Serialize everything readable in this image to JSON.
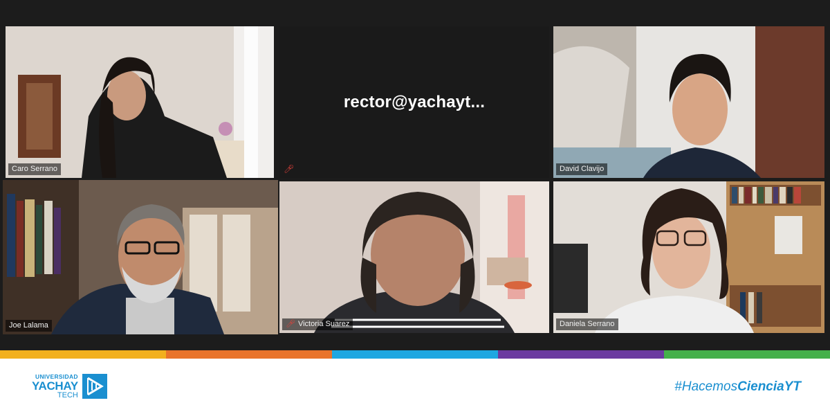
{
  "participants": [
    {
      "name": "Caro Serrano",
      "muted": false,
      "video": true
    },
    {
      "name": "rector@yachayt...",
      "muted": true,
      "video": false
    },
    {
      "name": "David Clavijo",
      "muted": false,
      "video": true
    },
    {
      "name": "Joe Lalama",
      "muted": false,
      "video": true,
      "active_speaker": true
    },
    {
      "name": "Victoria Suarez",
      "muted": true,
      "video": true
    },
    {
      "name": "Daniela Serrano",
      "muted": false,
      "video": true
    }
  ],
  "stripe_colors": [
    "#f2b01e",
    "#e9732a",
    "#1ea7e1",
    "#6b3aa0",
    "#44b04a"
  ],
  "footer": {
    "logo": {
      "line1": "UNIVERSIDAD",
      "line2": "YACHAY",
      "line3": "TECH"
    },
    "hashtag_prefix": "#Hacemos",
    "hashtag_bold": "CienciaYT"
  },
  "colors": {
    "brand_blue": "#1a8fd0",
    "active_speaker_border": "#d8e07a",
    "muted_icon": "#e0413a"
  }
}
